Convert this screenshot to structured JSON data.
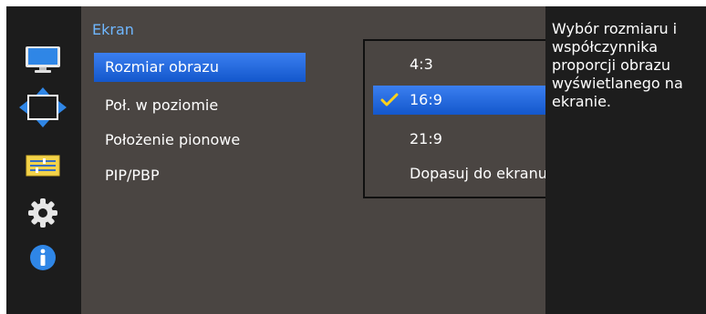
{
  "panel": {
    "title": "Ekran",
    "items": [
      {
        "label": "Rozmiar obrazu",
        "selected": true
      },
      {
        "label": "Poł. w poziomie",
        "selected": false
      },
      {
        "label": "Położenie pionowe",
        "selected": false
      },
      {
        "label": "PIP/PBP",
        "selected": false
      }
    ]
  },
  "popup": {
    "options": [
      {
        "label": "4:3",
        "selected": false
      },
      {
        "label": "16:9",
        "selected": true
      },
      {
        "label": "21:9",
        "selected": false
      },
      {
        "label": "Dopasuj do ekranu",
        "selected": false
      }
    ]
  },
  "help": {
    "text": "Wybór rozmiaru i współczynnika proporcji obrazu wyświetlanego na ekranie."
  },
  "sidebar": {
    "icons": [
      "monitor-icon",
      "move-arrows-icon",
      "settings-list-icon",
      "gear-icon",
      "info-icon"
    ]
  },
  "colors": {
    "accent": "#1f6ce0",
    "title": "#6fb7ff",
    "check": "#ffd21a"
  }
}
